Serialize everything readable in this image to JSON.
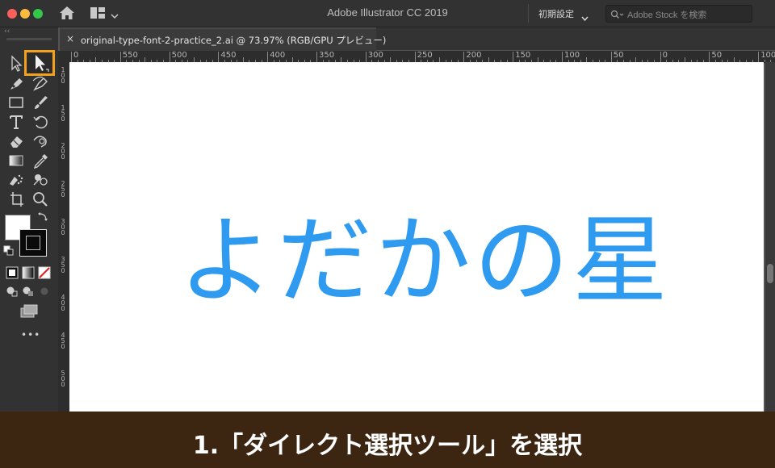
{
  "app": {
    "title": "Adobe Illustrator CC 2019",
    "workspace_label": "初期設定",
    "stock_search_placeholder": "Adobe Stock を検索"
  },
  "document": {
    "tab_label": "original-type-font-2-practice_2.ai @ 73.97% (RGB/GPU プレビュー)",
    "close_glyph": "×"
  },
  "ruler": {
    "horizontal_ticks": [
      "0",
      "550",
      "500",
      "450",
      "400",
      "350",
      "300",
      "250",
      "200",
      "150",
      "100",
      "50",
      "0",
      "50",
      "100"
    ],
    "vertical_ticks": [
      "100",
      "150",
      "200",
      "250",
      "300",
      "350",
      "400",
      "450",
      "500"
    ]
  },
  "artboard": {
    "text": "よだかの星",
    "text_color": "#2f9bf0"
  },
  "toolbar": {
    "selected_tool": "direct-selection-tool",
    "highlight_color": "#f3a11d",
    "more_tools_glyph": "•••",
    "collapse_glyph": "‹‹"
  },
  "caption": {
    "text": "1.「ダイレクト選択ツール」を選択",
    "background": "#3c2612"
  },
  "colors": {
    "fill": "#ffffff",
    "stroke": "#000000"
  }
}
